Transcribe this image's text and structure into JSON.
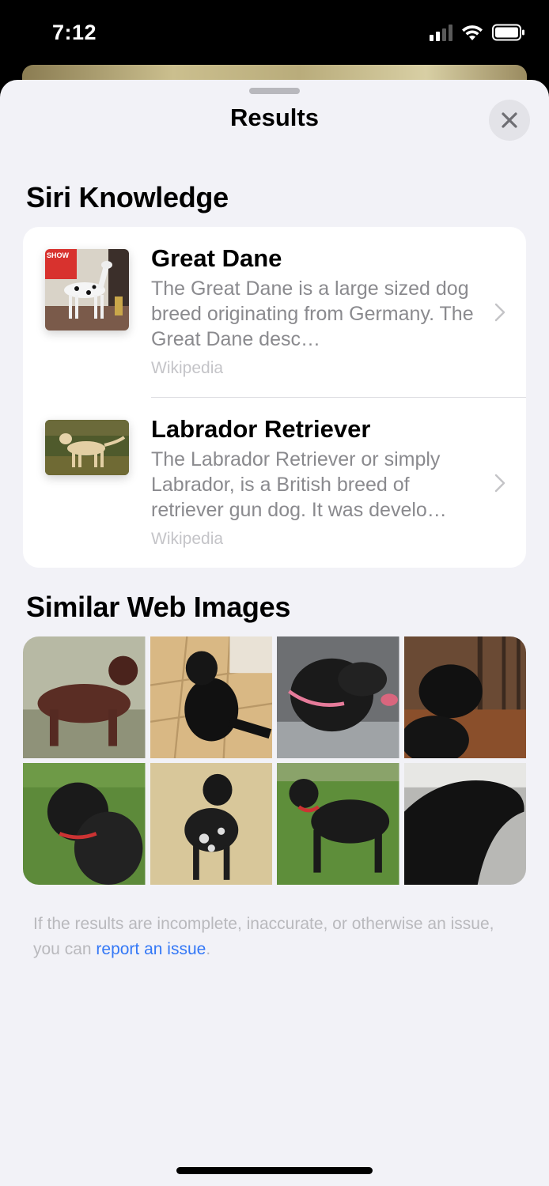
{
  "status_bar": {
    "time": "7:12",
    "signal_icon": "cellular-signal-icon",
    "wifi_icon": "wifi-icon",
    "battery_icon": "battery-icon"
  },
  "sheet": {
    "title": "Results",
    "close_icon": "close-icon"
  },
  "knowledge": {
    "heading": "Siri Knowledge",
    "items": [
      {
        "title": "Great Dane",
        "description": "The Great Dane is a large sized dog breed originating from Germany. The Great Dane desc…",
        "source": "Wikipedia",
        "thumb_icon": "great-dane-photo",
        "thumb_badge": "SHOW"
      },
      {
        "title": "Labrador Retriever",
        "description": "The Labrador Retriever or simply Labrador, is a British breed of retriever gun dog. It was develo…",
        "source": "Wikipedia",
        "thumb_icon": "labrador-retriever-photo"
      }
    ]
  },
  "similar_images": {
    "heading": "Similar Web Images",
    "count": 8
  },
  "footer": {
    "text_before": "If the results are incomplete, inaccurate, or otherwise an issue, you can ",
    "link": "report an issue",
    "text_after": "."
  },
  "colors": {
    "accent": "#3478f6",
    "sheet_background": "#f2f2f7",
    "card_background": "#ffffff"
  }
}
